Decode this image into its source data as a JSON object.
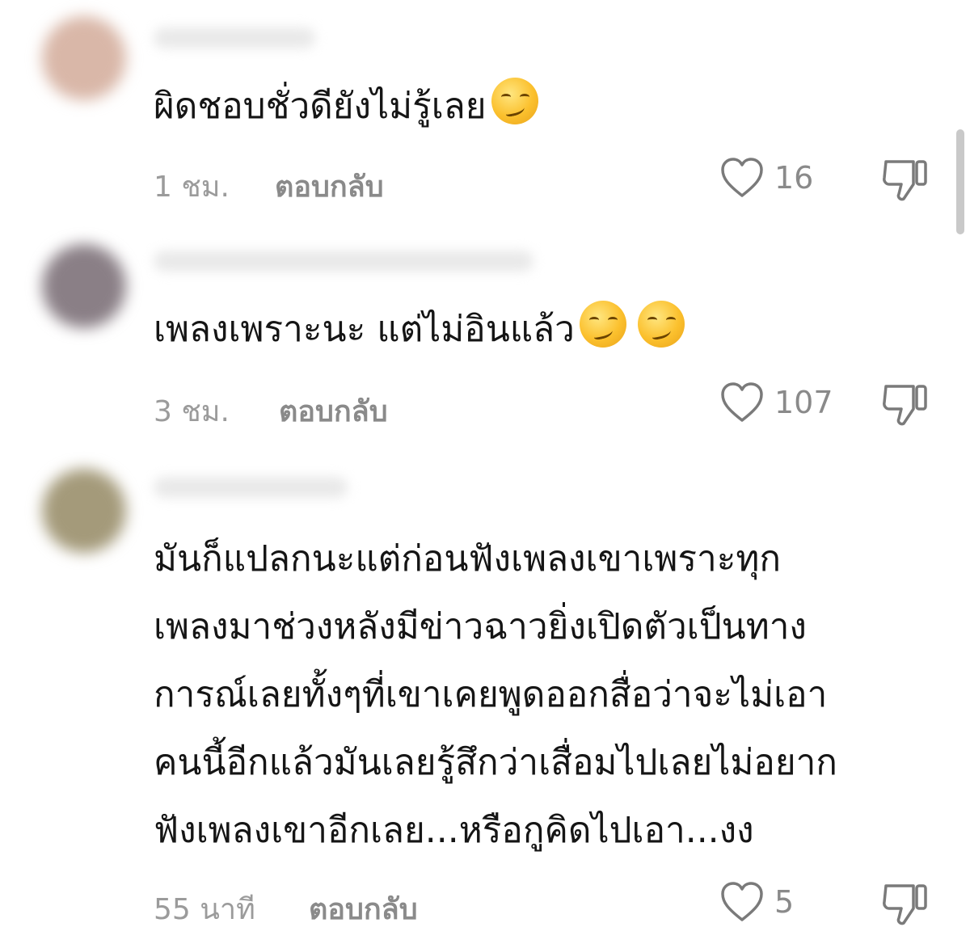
{
  "comments": [
    {
      "text": "ผิดชอบชั่วดียังไม่รู้เลย",
      "emoji_count": 1,
      "emoji_name": "smirking-face-emoji",
      "time": "1 ชม.",
      "reply_label": "ตอบกลับ",
      "likes": "16"
    },
    {
      "text": "เพลงเพราะนะ แต่ไม่อินแล้ว",
      "emoji_count": 2,
      "emoji_name": "smirking-face-emoji",
      "time": "3 ชม.",
      "reply_label": "ตอบกลับ",
      "likes": "107"
    },
    {
      "text_lines": [
        "มันก็แปลกนะแต่ก่อนฟังเพลงเขาเพราะทุก",
        "เพลงมาช่วงหลังมีข่าวฉาวยิ่งเปิดตัวเป็นทาง",
        "การณ์เลยทั้งๆที่เขาเคยพูดออกสื่อว่าจะไม่เอา",
        "คนนี้อีกแล้วมันเลยรู้สึกว่าเสื่อมไปเลยไม่อยาก",
        "ฟังเพลงเขาอีกเลย...หรือกูคิดไปเอา...งง"
      ],
      "time": "55 นาที",
      "reply_label": "ตอบกลับ",
      "likes": "5"
    }
  ],
  "icons": {
    "like": "heart-outline-icon",
    "dislike": "thumbs-down-outline-icon"
  },
  "colors": {
    "text": "#151515",
    "meta": "#9b9b9b",
    "icon": "#7a7a7a"
  }
}
